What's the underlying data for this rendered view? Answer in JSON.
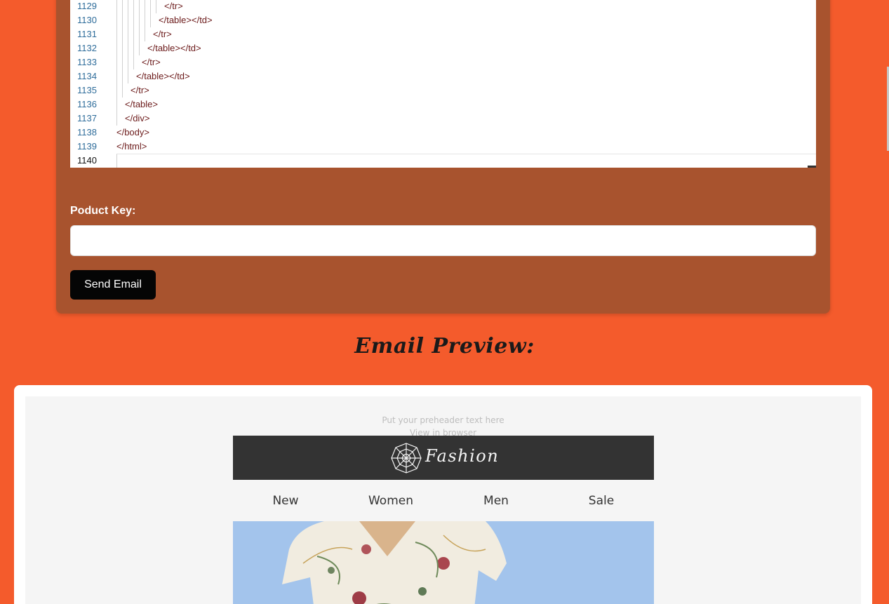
{
  "editor": {
    "lines": [
      {
        "num": "1129",
        "indent": 8,
        "code": "</tr>"
      },
      {
        "num": "1130",
        "indent": 7,
        "code": "</table></td>"
      },
      {
        "num": "1131",
        "indent": 6,
        "code": "</tr>"
      },
      {
        "num": "1132",
        "indent": 5,
        "code": "</table></td>"
      },
      {
        "num": "1133",
        "indent": 4,
        "code": "</tr>"
      },
      {
        "num": "1134",
        "indent": 3,
        "code": "</table></td>"
      },
      {
        "num": "1135",
        "indent": 2,
        "code": "</tr>"
      },
      {
        "num": "1136",
        "indent": 1,
        "code": "</table>"
      },
      {
        "num": "1137",
        "indent": 1,
        "code": "</div>"
      },
      {
        "num": "1138",
        "indent": 0,
        "code": "</body>"
      },
      {
        "num": "1139",
        "indent": 0,
        "code": "</html>"
      },
      {
        "num": "1140",
        "indent": 0,
        "code": ""
      }
    ]
  },
  "form": {
    "product_key_label": "Poduct Key:",
    "product_key_value": "",
    "send_label": "Send Email"
  },
  "preview": {
    "title": "Email Preview:",
    "preheader": "Put your preheader text here",
    "view_in_browser": "View in browser",
    "brand": "Fashion",
    "nav": [
      "New",
      "Women",
      "Men",
      "Sale"
    ]
  },
  "colors": {
    "page_bg": "#f45b2c",
    "panel_bg": "#a8532e",
    "button_bg": "#050505",
    "brand_bar": "#333333",
    "line_number": "#2e6c9a",
    "tag": "#6b1a1a"
  }
}
